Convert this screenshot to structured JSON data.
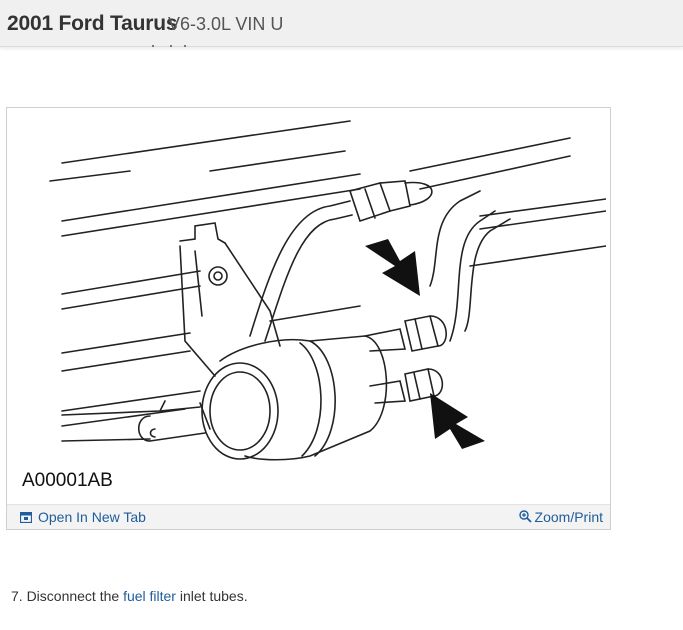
{
  "header": {
    "title": "2001 Ford Taurus",
    "subtitle": "V6-3.0L VIN U"
  },
  "figure": {
    "caption": "A00001AB",
    "open_tab_label": "Open In New Tab",
    "zoom_label": "Zoom/Print",
    "icons": {
      "open_tab": "open-new-tab-icon",
      "zoom": "zoom-icon"
    }
  },
  "step": {
    "prefix": "7. Disconnect the ",
    "link": "fuel filter",
    "suffix": " inlet tubes."
  },
  "colors": {
    "link": "#1f5d9b",
    "header_bg": "#f0f0f0",
    "footer_bg": "#f3f3f3"
  }
}
